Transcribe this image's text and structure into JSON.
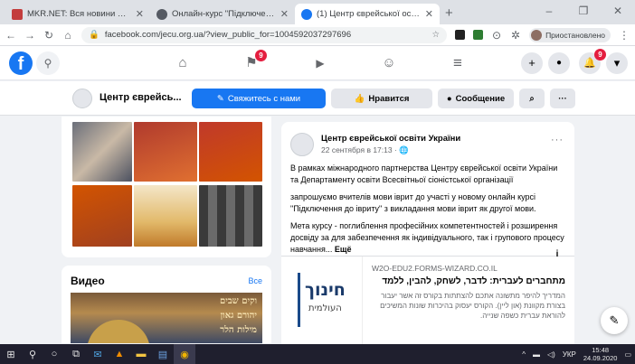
{
  "browser": {
    "tabs": [
      {
        "title": "MKR.NET: Вся новини України за ...",
        "favicon_color": "#c33d3d",
        "active": false
      },
      {
        "title": "Онлайн-курс \"Підключення до ...",
        "favicon_color": "#555a63",
        "active": false
      },
      {
        "title": "(1) Центр єврейської освіти Укр...",
        "favicon_color": "#1877f2",
        "active": true
      }
    ],
    "new_tab_label": "+",
    "url": "facebook.com/jecu.org.ua/?view_public_for=1004592037297696",
    "profile_label": "Приостановлено",
    "window_controls": [
      "–",
      "❐",
      "✕"
    ]
  },
  "fb_header": {
    "logo": "f",
    "nav": [
      {
        "name": "home",
        "glyph": "⌂"
      },
      {
        "name": "pages",
        "glyph": "⚑",
        "badge": "9"
      },
      {
        "name": "watch",
        "glyph": "▶"
      },
      {
        "name": "groups",
        "glyph": "☺"
      },
      {
        "name": "menu",
        "glyph": "≡"
      }
    ],
    "right_buttons": [
      {
        "name": "create",
        "glyph": "+"
      },
      {
        "name": "messenger",
        "glyph": "●"
      },
      {
        "name": "notifications",
        "glyph": "🔔",
        "badge": "9"
      },
      {
        "name": "account",
        "glyph": "▾"
      }
    ]
  },
  "page_bar": {
    "page_name": "Центр єврейсь...",
    "contact_button": "Свяжитесь с нами",
    "like_button": "Нравится",
    "message_button": "Сообщение",
    "search_glyph": "⌕",
    "more_glyph": "···"
  },
  "videos": {
    "title": "Видео",
    "see_all": "Все",
    "thumb_lines": [
      "וקים שבים",
      "יהורם גאון",
      "מילות הלר"
    ]
  },
  "post": {
    "author": "Центр єврейської освіти України",
    "date": "22 сентября в 17:13 · 🌐",
    "paragraphs": [
      "В рамках міжнародного партнерства Центру єврейської освіти України та Департаменту освіти Всесвітньої сіоністської організації",
      "запрошуємо вчителів мови іврит до участі у новому онлайн курсі \"Підключення до івриту\" з викладання мови іврит як другої мови.",
      "Мета курсу - поглиблення професійних компетентностей і розширення досвіду за для забезпечення як індивідуального, так і групового процесу навчання..."
    ],
    "see_more": "Ещё",
    "link": {
      "image_text_1": "חינוך",
      "image_text_2": "העולמית",
      "domain": "W2O-EDU2.FORMS-WIZARD.CO.IL",
      "title": "מתחברים לעברית: לדבר, לשחק, להבין, ללמד",
      "description": "המדריך להיפר מתשונה אתכם להצתתות בקורס זה אשר יעבור בצורת מקוונת (און ליין). הקורס יעסוק בהיכרות שונות המשיכים להוראת עברית כשפה שנייה.",
      "info": "i"
    }
  },
  "taskbar": {
    "apps": [
      "⊞",
      "⚲",
      "○",
      "⧉",
      "✉",
      "▲",
      "▬",
      "▤",
      "◉"
    ],
    "tray_lang": "УКР",
    "time": "15:48",
    "date": "24.09.2020"
  },
  "colors": {
    "fb_blue": "#1877f2",
    "badge_red": "#e41e3f",
    "taskbar": "#1f1f2e"
  }
}
